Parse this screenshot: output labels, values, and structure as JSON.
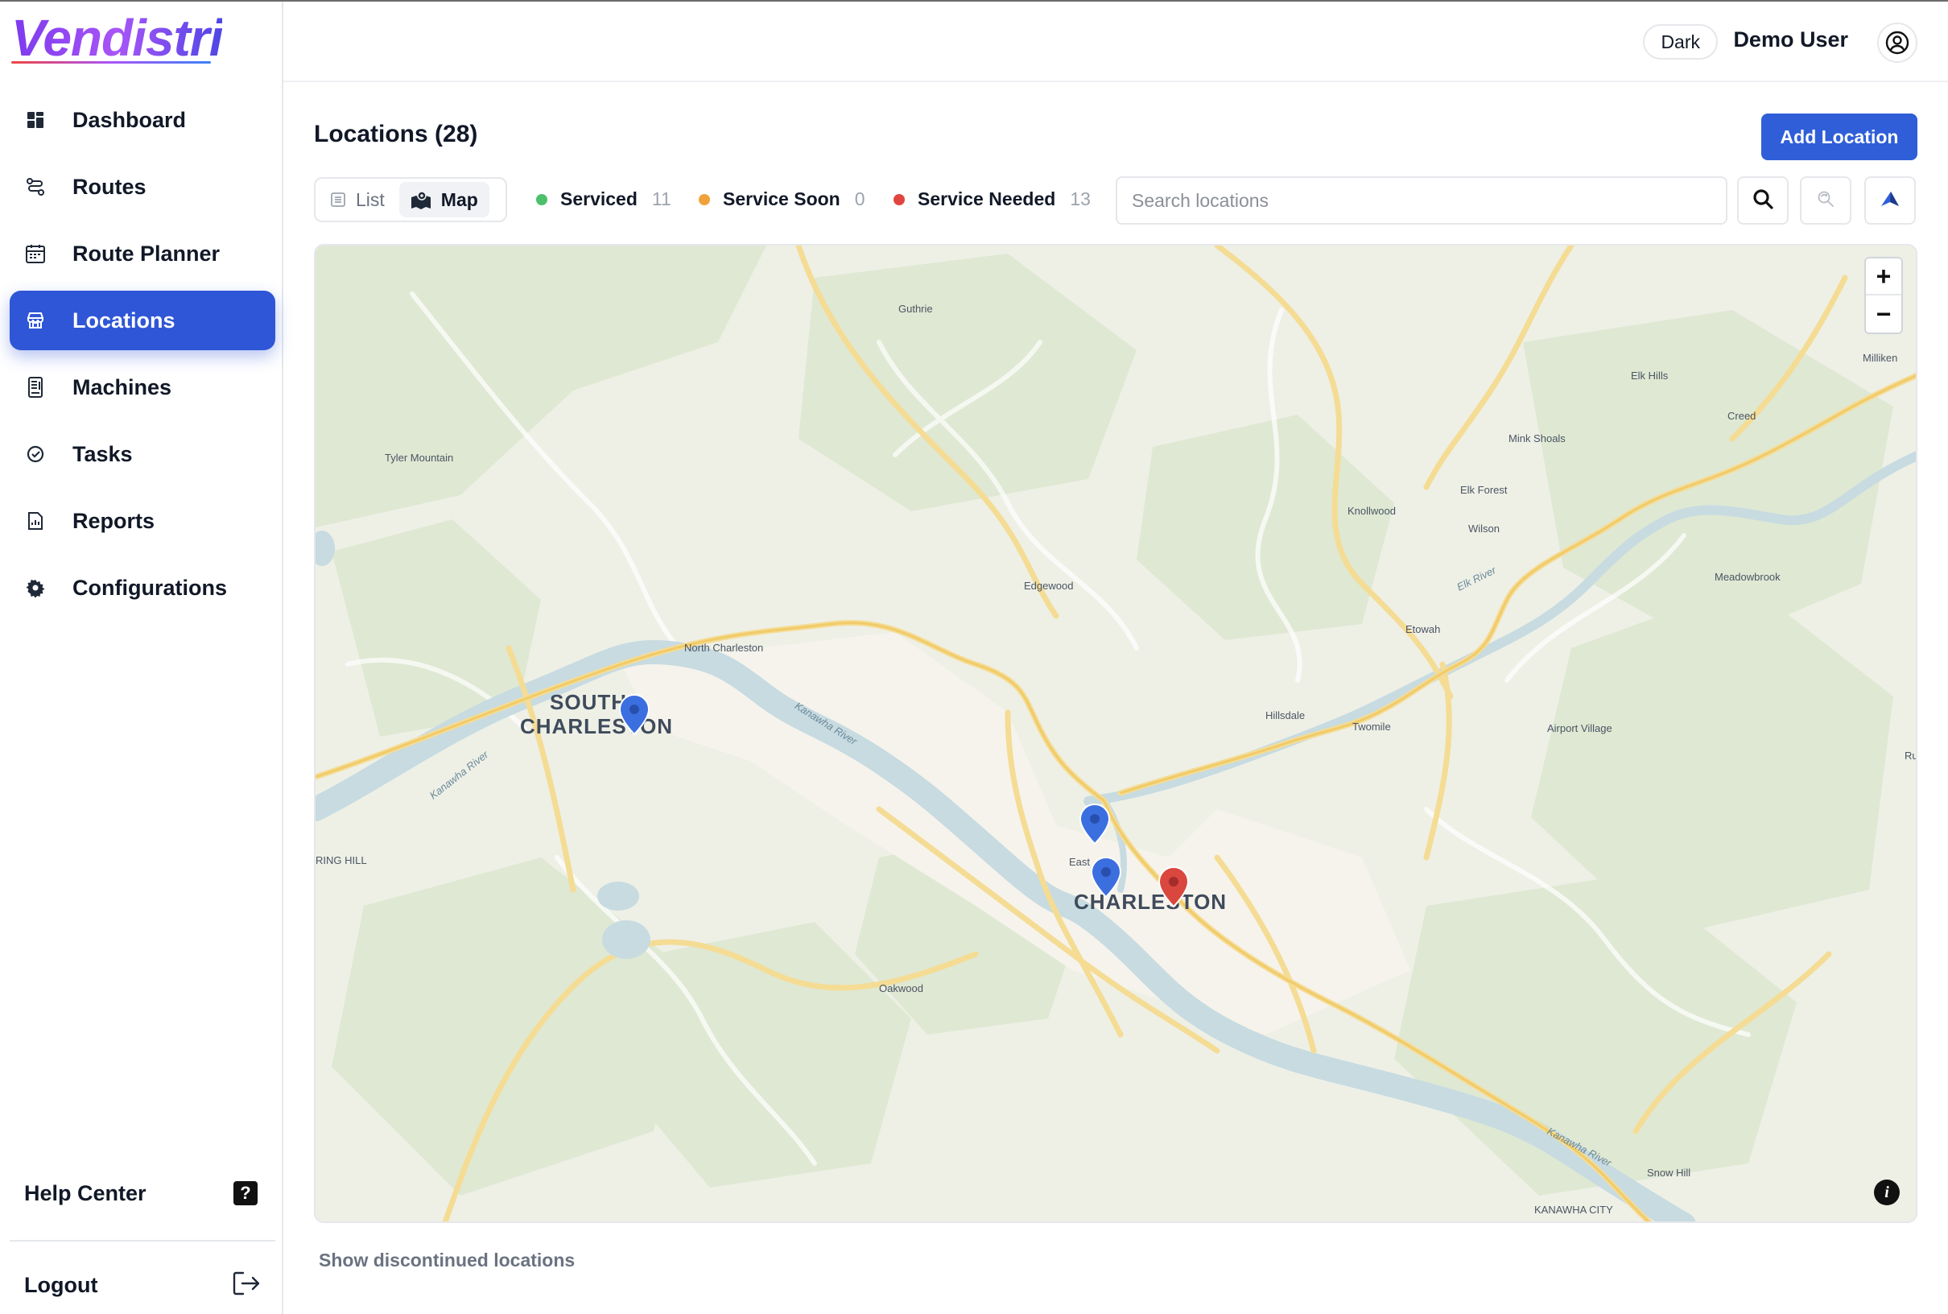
{
  "brand": {
    "name": "Vendistri"
  },
  "nav": {
    "items": [
      {
        "label": "Dashboard"
      },
      {
        "label": "Routes"
      },
      {
        "label": "Route Planner"
      },
      {
        "label": "Locations"
      },
      {
        "label": "Machines"
      },
      {
        "label": "Tasks"
      },
      {
        "label": "Reports"
      },
      {
        "label": "Configurations"
      }
    ],
    "help_label": "Help Center",
    "help_icon": "?",
    "logout_label": "Logout"
  },
  "topbar": {
    "theme_label": "Dark",
    "user_name": "Demo User"
  },
  "page": {
    "title": "Locations (28)",
    "add_label": "Add Location",
    "discontinued_label": "Show discontinued locations"
  },
  "view_toggle": {
    "list_label": "List",
    "map_label": "Map",
    "selected": "Map"
  },
  "legend": [
    {
      "name": "Serviced",
      "count": "11",
      "color": "#4cc06a"
    },
    {
      "name": "Service Soon",
      "count": "0",
      "color": "#f0a23a"
    },
    {
      "name": "Service Needed",
      "count": "13",
      "color": "#e0463f"
    }
  ],
  "search": {
    "placeholder": "Search locations",
    "value": ""
  },
  "map": {
    "zoom_in": "+",
    "zoom_out": "−",
    "info": "i",
    "cities": [
      {
        "name": "SOUTH CHARLESTON"
      },
      {
        "name": "CHARLESTON"
      }
    ],
    "places": [
      "Guthrie",
      "Tyler Mountain",
      "Elk Hills",
      "Milliken",
      "Creed",
      "Mink Shoals",
      "Elk Forest",
      "Knollwood",
      "Wilson",
      "Meadowbrook",
      "Edgewood",
      "Etowah",
      "North Charleston",
      "Hillsdale",
      "Twomile",
      "Airport Village",
      "RING HILL",
      "East",
      "Oakwood",
      "Snow Hill",
      "KANAWHA CITY",
      "Ru"
    ],
    "rivers": [
      "Kanawha River",
      "Kanawha River",
      "Elk River",
      "Kanawha River"
    ],
    "pin_colors": {
      "serviced": "#3b6fe0",
      "needed": "#d9473f"
    }
  }
}
